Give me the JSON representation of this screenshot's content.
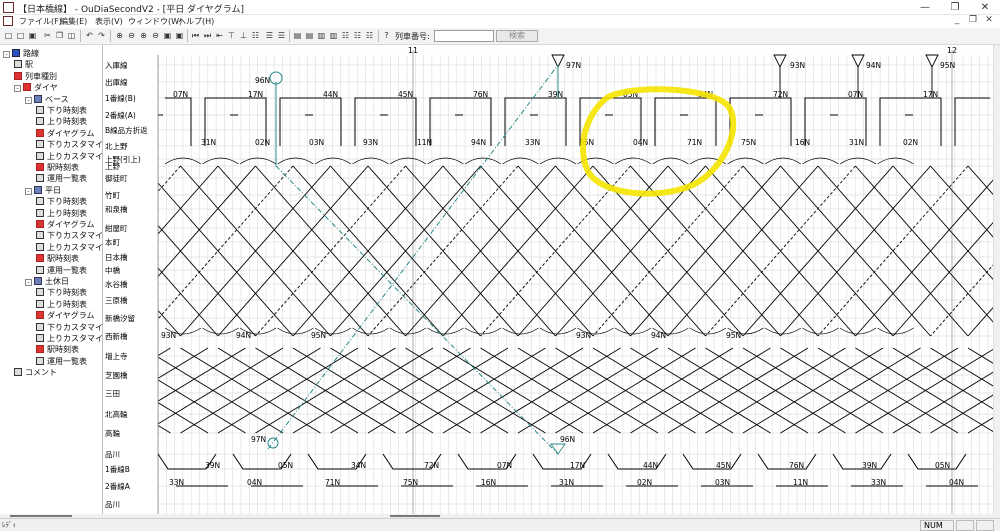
{
  "window": {
    "title": "【日本橋線】 - OuDiaSecondV2 - [平日 ダイヤグラム]"
  },
  "menu": {
    "items": [
      "ファイル(F)",
      "編集(E)",
      "表示(V)",
      "ウィンドウ(W)",
      "ヘルプ(H)"
    ]
  },
  "toolbar": {
    "train_number_label": "列車番号:",
    "train_number_value": "",
    "search_label": "検索"
  },
  "tree": {
    "items": [
      {
        "label": "路線",
        "depth": 0,
        "icon": "route-icon",
        "exp": "-"
      },
      {
        "label": "駅",
        "depth": 1,
        "icon": "station-icon"
      },
      {
        "label": "列車種別",
        "depth": 1,
        "icon": "train-type-icon"
      },
      {
        "label": "ダイヤ",
        "depth": 1,
        "icon": "dia-icon",
        "exp": "-"
      },
      {
        "label": "ベース",
        "depth": 2,
        "icon": "folder-icon",
        "exp": "-"
      },
      {
        "label": "下り時刻表",
        "depth": 3,
        "icon": "timetable-icon"
      },
      {
        "label": "上り時刻表",
        "depth": 3,
        "icon": "timetable-icon"
      },
      {
        "label": "ダイヤグラム",
        "depth": 3,
        "icon": "diagram-icon"
      },
      {
        "label": "下りカスタマイズ",
        "depth": 3,
        "icon": "timetable-icon"
      },
      {
        "label": "上りカスタマイズ",
        "depth": 3,
        "icon": "timetable-icon"
      },
      {
        "label": "駅時刻表",
        "depth": 3,
        "icon": "station-timetable-icon"
      },
      {
        "label": "運用一覧表",
        "depth": 3,
        "icon": "operation-icon"
      },
      {
        "label": "平日",
        "depth": 2,
        "icon": "folder-icon",
        "exp": "-"
      },
      {
        "label": "下り時刻表",
        "depth": 3,
        "icon": "timetable-icon"
      },
      {
        "label": "上り時刻表",
        "depth": 3,
        "icon": "timetable-icon"
      },
      {
        "label": "ダイヤグラム",
        "depth": 3,
        "icon": "diagram-icon"
      },
      {
        "label": "下りカスタマイズ",
        "depth": 3,
        "icon": "timetable-icon"
      },
      {
        "label": "上りカスタマイズ",
        "depth": 3,
        "icon": "timetable-icon"
      },
      {
        "label": "駅時刻表",
        "depth": 3,
        "icon": "station-timetable-icon"
      },
      {
        "label": "運用一覧表",
        "depth": 3,
        "icon": "operation-icon"
      },
      {
        "label": "土休日",
        "depth": 2,
        "icon": "folder-icon",
        "exp": "-"
      },
      {
        "label": "下り時刻表",
        "depth": 3,
        "icon": "timetable-icon"
      },
      {
        "label": "上り時刻表",
        "depth": 3,
        "icon": "timetable-icon"
      },
      {
        "label": "ダイヤグラム",
        "depth": 3,
        "icon": "diagram-icon"
      },
      {
        "label": "下りカスタマイズ",
        "depth": 3,
        "icon": "timetable-icon"
      },
      {
        "label": "上りカスタマイズ",
        "depth": 3,
        "icon": "timetable-icon"
      },
      {
        "label": "駅時刻表",
        "depth": 3,
        "icon": "station-timetable-icon"
      },
      {
        "label": "運用一覧表",
        "depth": 3,
        "icon": "operation-icon"
      },
      {
        "label": "コメント",
        "depth": 1,
        "icon": "comment-icon"
      }
    ]
  },
  "diagram": {
    "hour_labels": [
      "11",
      "12"
    ],
    "stations": [
      "入庫線",
      "出庫線",
      "1番線(B)",
      "2番線(A)",
      "B線品方折返",
      "北上野",
      "上野(引上)",
      "上野",
      "御徒町",
      "竹町",
      "和泉橋",
      "紺屋町",
      "本町",
      "日本橋",
      "中橋",
      "水谷橋",
      "三原橋",
      "新橋汐留",
      "西新橋",
      "増上寺",
      "芝園橋",
      "三田",
      "北高輪",
      "高輪",
      "品川",
      "1番線B",
      "2番線A",
      "品川"
    ],
    "top_b_labels": [
      "07N",
      "17N",
      "44N",
      "45N",
      "76N",
      "39N",
      "05N",
      "34N",
      "72N",
      "07N",
      "17N"
    ],
    "top_a_labels": [
      "31N",
      "02N",
      "03N",
      "93N",
      "11N",
      "94N",
      "33N",
      "95N",
      "04N",
      "71N",
      "75N",
      "16N",
      "31N",
      "02N"
    ],
    "depot_labels": [
      "96N",
      "97N",
      "93N",
      "94N",
      "95N"
    ],
    "mid_labels": [
      "93N",
      "94N",
      "95N",
      "93N",
      "94N",
      "95N"
    ],
    "bottom_b_labels": [
      "39N",
      "05N",
      "34N",
      "72N",
      "07N",
      "17N",
      "44N",
      "45N",
      "76N",
      "39N",
      "05N"
    ],
    "bottom_a_labels": [
      "33N",
      "04N",
      "71N",
      "75N",
      "16N",
      "31N",
      "02N",
      "03N",
      "11N",
      "33N",
      "04N"
    ],
    "bottom_depot_labels": [
      "97N",
      "96N"
    ],
    "highlight_color": "#f5e400",
    "line_color": "#000000",
    "deadhead_color": "#2a8a8a"
  },
  "status": {
    "text": "ﾚﾃﾞｨ",
    "num": "NUM"
  }
}
